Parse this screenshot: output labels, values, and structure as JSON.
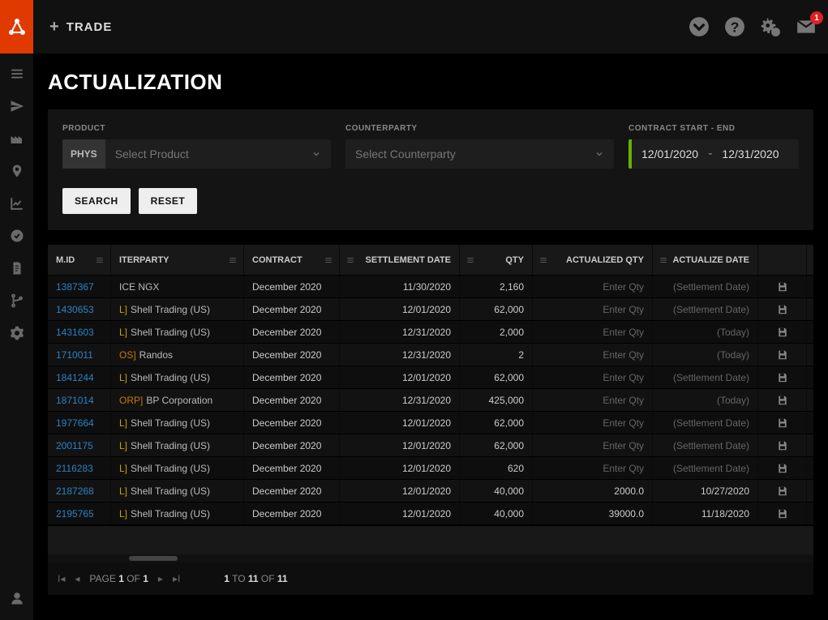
{
  "header": {
    "trade_label": "TRADE",
    "envelope_badge": "1"
  },
  "page": {
    "title": "ACTUALIZATION"
  },
  "filters": {
    "product": {
      "label": "PRODUCT",
      "chip": "PHYS",
      "placeholder": "Select Product"
    },
    "counterparty": {
      "label": "COUNTERPARTY",
      "placeholder": "Select Counterparty"
    },
    "contract": {
      "label": "CONTRACT START - END",
      "start": "12/01/2020",
      "end": "12/31/2020",
      "sep": "-"
    },
    "search_btn": "SEARCH",
    "reset_btn": "RESET"
  },
  "grid": {
    "headers": {
      "mid": "M.ID",
      "counterparty": "ITERPARTY",
      "contract": "CONTRACT",
      "settlement": "SETTLEMENT DATE",
      "qty": "QTY",
      "aqty": "ACTUALIZED QTY",
      "adate": "ACTUALIZE DATE"
    },
    "rows": [
      {
        "mid": "1387367",
        "cp_code": "",
        "cp_name": "ICE NGX",
        "code_class": "",
        "contract": "December 2020",
        "settlement": "11/30/2020",
        "qty": "2,160",
        "aqty": "",
        "adate": "",
        "aqty_ph": "Enter Qty",
        "adate_ph": "(Settlement Date)"
      },
      {
        "mid": "1430653",
        "cp_code": "L]",
        "cp_name": "Shell Trading (US)",
        "code_class": "",
        "contract": "December 2020",
        "settlement": "12/01/2020",
        "qty": "62,000",
        "aqty": "",
        "adate": "",
        "aqty_ph": "Enter Qty",
        "adate_ph": "(Settlement Date)"
      },
      {
        "mid": "1431603",
        "cp_code": "L]",
        "cp_name": "Shell Trading (US)",
        "code_class": "",
        "contract": "December 2020",
        "settlement": "12/31/2020",
        "qty": "2,000",
        "aqty": "",
        "adate": "",
        "aqty_ph": "Enter Qty",
        "adate_ph": "(Today)"
      },
      {
        "mid": "1710011",
        "cp_code": "OS]",
        "cp_name": "Randos",
        "code_class": "alt",
        "contract": "December 2020",
        "settlement": "12/31/2020",
        "qty": "2",
        "aqty": "",
        "adate": "",
        "aqty_ph": "Enter Qty",
        "adate_ph": "(Today)"
      },
      {
        "mid": "1841244",
        "cp_code": "L]",
        "cp_name": "Shell Trading (US)",
        "code_class": "",
        "contract": "December 2020",
        "settlement": "12/01/2020",
        "qty": "62,000",
        "aqty": "",
        "adate": "",
        "aqty_ph": "Enter Qty",
        "adate_ph": "(Settlement Date)"
      },
      {
        "mid": "1871014",
        "cp_code": "ORP]",
        "cp_name": "BP Corporation",
        "code_class": "alt",
        "contract": "December 2020",
        "settlement": "12/31/2020",
        "qty": "425,000",
        "aqty": "",
        "adate": "",
        "aqty_ph": "Enter Qty",
        "adate_ph": "(Today)"
      },
      {
        "mid": "1977664",
        "cp_code": "L]",
        "cp_name": "Shell Trading (US)",
        "code_class": "",
        "contract": "December 2020",
        "settlement": "12/01/2020",
        "qty": "62,000",
        "aqty": "",
        "adate": "",
        "aqty_ph": "Enter Qty",
        "adate_ph": "(Settlement Date)"
      },
      {
        "mid": "2001175",
        "cp_code": "L]",
        "cp_name": "Shell Trading (US)",
        "code_class": "",
        "contract": "December 2020",
        "settlement": "12/01/2020",
        "qty": "62,000",
        "aqty": "",
        "adate": "",
        "aqty_ph": "Enter Qty",
        "adate_ph": "(Settlement Date)"
      },
      {
        "mid": "2116283",
        "cp_code": "L]",
        "cp_name": "Shell Trading (US)",
        "code_class": "",
        "contract": "December 2020",
        "settlement": "12/01/2020",
        "qty": "620",
        "aqty": "",
        "adate": "",
        "aqty_ph": "Enter Qty",
        "adate_ph": "(Settlement Date)"
      },
      {
        "mid": "2187268",
        "cp_code": "L]",
        "cp_name": "Shell Trading (US)",
        "code_class": "",
        "contract": "December 2020",
        "settlement": "12/01/2020",
        "qty": "40,000",
        "aqty": "2000.0",
        "adate": "10/27/2020",
        "aqty_ph": "",
        "adate_ph": ""
      },
      {
        "mid": "2195765",
        "cp_code": "L]",
        "cp_name": "Shell Trading (US)",
        "code_class": "",
        "contract": "December 2020",
        "settlement": "12/01/2020",
        "qty": "40,000",
        "aqty": "39000.0",
        "adate": "11/18/2020",
        "aqty_ph": "",
        "adate_ph": ""
      }
    ]
  },
  "pager": {
    "page_prefix": "PAGE ",
    "page_cur": "1",
    "page_of": " OF ",
    "page_total": "1",
    "range_a": "1",
    "range_to": " TO ",
    "range_b": "11",
    "range_of": " OF ",
    "range_total": "11"
  }
}
